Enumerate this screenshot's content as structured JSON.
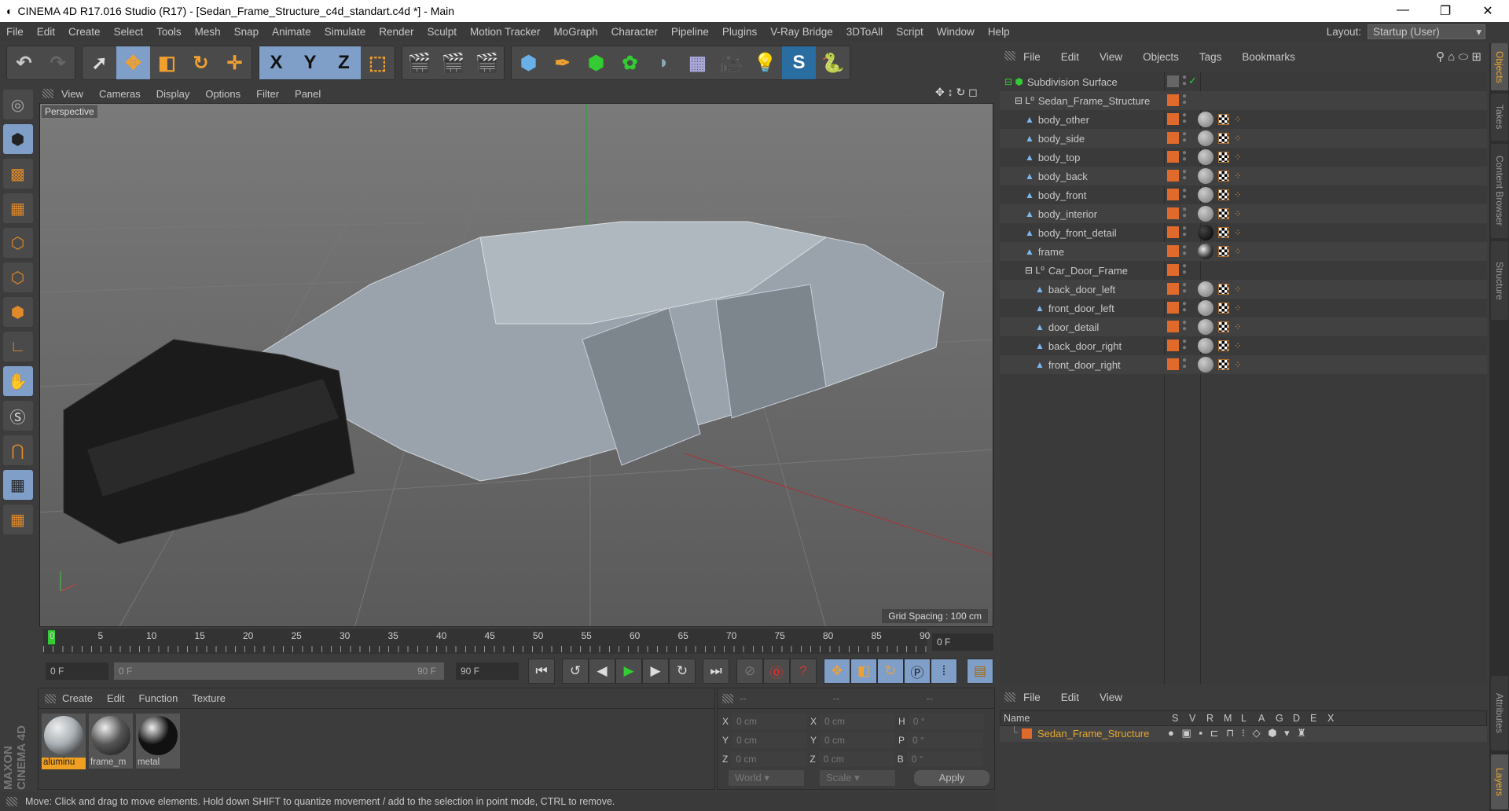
{
  "title": "CINEMA 4D R17.016 Studio (R17) - [Sedan_Frame_Structure_c4d_standart.c4d *] - Main",
  "menu": [
    "File",
    "Edit",
    "Create",
    "Select",
    "Tools",
    "Mesh",
    "Snap",
    "Animate",
    "Simulate",
    "Render",
    "Sculpt",
    "Motion Tracker",
    "MoGraph",
    "Character",
    "Pipeline",
    "Plugins",
    "V-Ray Bridge",
    "3DToAll",
    "Script",
    "Window",
    "Help"
  ],
  "layout": {
    "label": "Layout:",
    "value": "Startup (User)"
  },
  "toolbar": {
    "x": "X",
    "y": "Y",
    "z": "Z"
  },
  "viewport": {
    "menu": [
      "View",
      "Cameras",
      "Display",
      "Options",
      "Filter",
      "Panel"
    ],
    "label": "Perspective",
    "grid_spacing": "Grid Spacing : 100 cm"
  },
  "timeline": {
    "ticks": [
      "0",
      "5",
      "10",
      "15",
      "20",
      "25",
      "30",
      "35",
      "40",
      "45",
      "50",
      "55",
      "60",
      "65",
      "70",
      "75",
      "80",
      "85",
      "90"
    ],
    "current": "0 F",
    "start": "0 F",
    "range_start": "0 F",
    "range_end": "90 F",
    "end": "90 F"
  },
  "materials": {
    "menu": [
      "Create",
      "Edit",
      "Function",
      "Texture"
    ],
    "items": [
      {
        "name": "aluminu",
        "color": "#a9b0b5"
      },
      {
        "name": "frame_m",
        "color": "#555"
      },
      {
        "name": "metal",
        "color": "#111"
      }
    ]
  },
  "coords": {
    "headers": [
      "--",
      "--",
      "--"
    ],
    "rows": [
      {
        "a": "X",
        "av": "0 cm",
        "b": "X",
        "bv": "0 cm",
        "c": "H",
        "cv": "0 °"
      },
      {
        "a": "Y",
        "av": "0 cm",
        "b": "Y",
        "bv": "0 cm",
        "c": "P",
        "cv": "0 °"
      },
      {
        "a": "Z",
        "av": "0 cm",
        "b": "Z",
        "bv": "0 cm",
        "c": "B",
        "cv": "0 °"
      }
    ],
    "world": "World",
    "scale": "Scale",
    "apply": "Apply"
  },
  "status": "Move: Click and drag to move elements. Hold down SHIFT to quantize movement / add to the selection in point mode, CTRL to remove.",
  "object_manager": {
    "menu": [
      "File",
      "Edit",
      "View",
      "Objects",
      "Tags",
      "Bookmarks"
    ],
    "objects": [
      {
        "name": "Subdivision Surface",
        "depth": 0,
        "type": "subdiv"
      },
      {
        "name": "Sedan_Frame_Structure",
        "depth": 1,
        "type": "null"
      },
      {
        "name": "body_other",
        "depth": 2,
        "type": "poly",
        "mat": "grey"
      },
      {
        "name": "body_side",
        "depth": 2,
        "type": "poly",
        "mat": "grey"
      },
      {
        "name": "body_top",
        "depth": 2,
        "type": "poly",
        "mat": "grey"
      },
      {
        "name": "body_back",
        "depth": 2,
        "type": "poly",
        "mat": "grey"
      },
      {
        "name": "body_front",
        "depth": 2,
        "type": "poly",
        "mat": "grey"
      },
      {
        "name": "body_interior",
        "depth": 2,
        "type": "poly",
        "mat": "grey"
      },
      {
        "name": "body_front_detail",
        "depth": 2,
        "type": "poly",
        "mat": "black"
      },
      {
        "name": "frame",
        "depth": 2,
        "type": "poly",
        "mat": "chrome"
      },
      {
        "name": "Car_Door_Frame",
        "depth": 2,
        "type": "null"
      },
      {
        "name": "back_door_left",
        "depth": 3,
        "type": "poly",
        "mat": "grey"
      },
      {
        "name": "front_door_left",
        "depth": 3,
        "type": "poly",
        "mat": "grey"
      },
      {
        "name": "door_detail",
        "depth": 3,
        "type": "poly",
        "mat": "grey"
      },
      {
        "name": "back_door_right",
        "depth": 3,
        "type": "poly",
        "mat": "grey"
      },
      {
        "name": "front_door_right",
        "depth": 3,
        "type": "poly",
        "mat": "grey"
      }
    ]
  },
  "layers": {
    "menu": [
      "File",
      "Edit",
      "View"
    ],
    "columns": [
      "Name",
      "S",
      "V",
      "R",
      "M",
      "L",
      "A",
      "G",
      "D",
      "E",
      "X"
    ],
    "layer": "Sedan_Frame_Structure"
  },
  "side_tabs": [
    "Objects",
    "Takes",
    "Content Browser",
    "Structure",
    "Attributes",
    "Layers"
  ],
  "brand": "MAXON CINEMA 4D"
}
